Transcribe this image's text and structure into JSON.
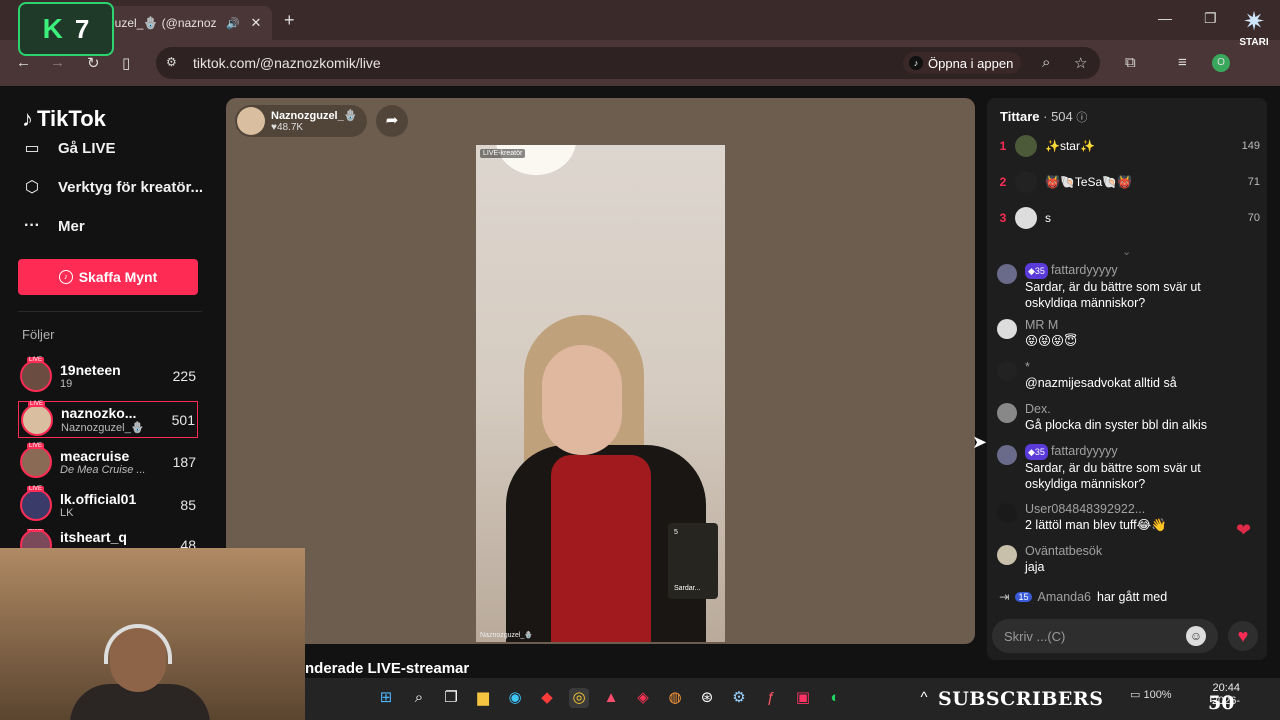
{
  "browser": {
    "tab_title": "guzel_🪬 (@naznoz",
    "tab_audio_icon": "speaker-icon",
    "url": "tiktok.com/@naznozkomik/live",
    "open_in_app": "Öppna i appen"
  },
  "overlay": {
    "k7_letter": "K",
    "k7_number": "7",
    "stari_label": "STARI"
  },
  "sidebar": {
    "logo": "TikTok",
    "go_live": "Gå LIVE",
    "creator_tools": "Verktyg för kreatör...",
    "more": "Mer",
    "get_coins": "Skaffa Mynt",
    "following_title": "Följer",
    "following": [
      {
        "name": "19neteen",
        "sub": "19",
        "count": "225"
      },
      {
        "name": "naznozko...",
        "sub": "Naznozguzel_🪬",
        "count": "501"
      },
      {
        "name": "meacruise",
        "sub": "De Mea Cruise ...",
        "count": "187"
      },
      {
        "name": "lk.official01",
        "sub": "LK",
        "count": "85"
      },
      {
        "name": "itsheart_q",
        "sub": "",
        "count": "48"
      }
    ]
  },
  "stream": {
    "host_name": "Naznozguzel_🪬",
    "host_likes": "♥48.7K",
    "live_tag": "LIVE-kreatör",
    "guest_label": "Sardar...",
    "guest_count": "5",
    "video_credit": "Naznozguzel_🪬",
    "below_heading": "nderade LIVE-streamar"
  },
  "viewers": {
    "label": "Tittare",
    "count": "· 504",
    "top": [
      {
        "rank": "1",
        "name": "✨star✨",
        "score": "149"
      },
      {
        "rank": "2",
        "name": "👹🐚TeSa🐚👹",
        "score": "71"
      },
      {
        "rank": "3",
        "name": "s",
        "score": "70"
      }
    ]
  },
  "chat": [
    {
      "user": "fattardyyyyy",
      "badge": "35",
      "text": "Sardar, är du bättre som svär ut oskyldiga människor?"
    },
    {
      "user": "MR M",
      "badge": "",
      "text": "😝😝😝😇"
    },
    {
      "user": "*",
      "badge": "",
      "text": "@nazmijesadvokat alltid så"
    },
    {
      "user": "Dex.",
      "badge": "",
      "text": "Gå plocka din syster bbl din alkis"
    },
    {
      "user": "fattardyyyyy",
      "badge": "35",
      "text": "Sardar, är du bättre som svär ut oskyldiga människor?"
    },
    {
      "user": "User084848392922...",
      "badge": "",
      "text": "2 lättöl man blev tuff😂👋"
    },
    {
      "user": "Oväntatbesök",
      "badge": "",
      "text": "jaja"
    }
  ],
  "joined": {
    "badge": "15",
    "user": "Amanda6",
    "text": "har gått med"
  },
  "compose": {
    "placeholder": "Skriv ...(C)"
  },
  "taskbar": {
    "subscribers": "SUBSCRIBERS",
    "battery": "100%",
    "time": "20:44",
    "date": "2026-",
    "sub_count": "50"
  },
  "colors": {
    "accent": "#fe2c55",
    "panel": "#1e1e1e",
    "stage": "#6d5d4e"
  }
}
